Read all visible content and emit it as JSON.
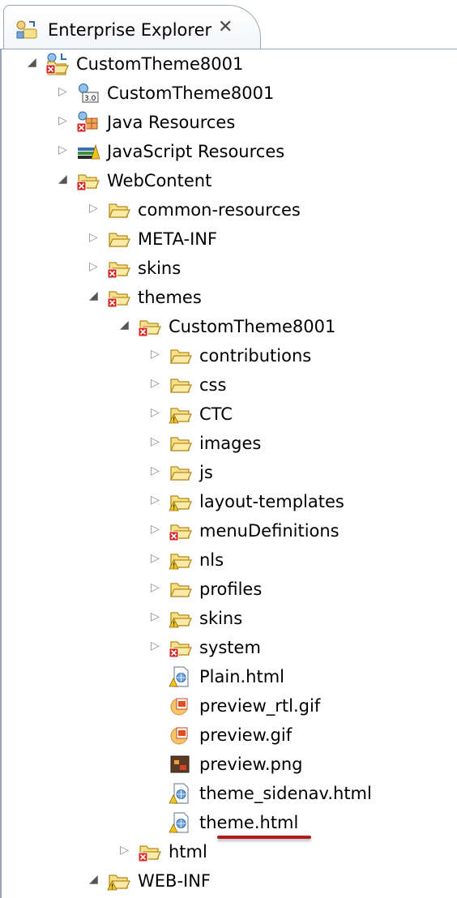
{
  "view": {
    "title": "Enterprise Explorer",
    "close_glyph": "✕"
  },
  "tree": [
    {
      "label": "CustomTheme8001",
      "depth": 0,
      "expanded": true,
      "icon": "project-icon"
    },
    {
      "label": "CustomTheme8001",
      "depth": 1,
      "expanded": false,
      "icon": "deployment-descriptor-icon"
    },
    {
      "label": "Java Resources",
      "depth": 1,
      "expanded": false,
      "icon": "java-resources-icon"
    },
    {
      "label": "JavaScript Resources",
      "depth": 1,
      "expanded": false,
      "icon": "javascript-resources-icon"
    },
    {
      "label": "WebContent",
      "depth": 1,
      "expanded": true,
      "icon": "folder-error-icon"
    },
    {
      "label": "common-resources",
      "depth": 2,
      "expanded": false,
      "icon": "folder-icon"
    },
    {
      "label": "META-INF",
      "depth": 2,
      "expanded": false,
      "icon": "folder-icon"
    },
    {
      "label": "skins",
      "depth": 2,
      "expanded": false,
      "icon": "folder-error-icon"
    },
    {
      "label": "themes",
      "depth": 2,
      "expanded": true,
      "icon": "folder-error-icon"
    },
    {
      "label": "CustomTheme8001",
      "depth": 3,
      "expanded": true,
      "icon": "folder-error-icon"
    },
    {
      "label": "contributions",
      "depth": 4,
      "expanded": false,
      "icon": "folder-icon"
    },
    {
      "label": "css",
      "depth": 4,
      "expanded": false,
      "icon": "folder-icon"
    },
    {
      "label": "CTC",
      "depth": 4,
      "expanded": false,
      "icon": "folder-warning-icon"
    },
    {
      "label": "images",
      "depth": 4,
      "expanded": false,
      "icon": "folder-icon"
    },
    {
      "label": "js",
      "depth": 4,
      "expanded": false,
      "icon": "folder-icon"
    },
    {
      "label": "layout-templates",
      "depth": 4,
      "expanded": false,
      "icon": "folder-warning-icon"
    },
    {
      "label": "menuDefinitions",
      "depth": 4,
      "expanded": false,
      "icon": "folder-error-icon"
    },
    {
      "label": "nls",
      "depth": 4,
      "expanded": false,
      "icon": "folder-warning-icon"
    },
    {
      "label": "profiles",
      "depth": 4,
      "expanded": false,
      "icon": "folder-icon"
    },
    {
      "label": "skins",
      "depth": 4,
      "expanded": false,
      "icon": "folder-warning-icon"
    },
    {
      "label": "system",
      "depth": 4,
      "expanded": false,
      "icon": "folder-error-icon"
    },
    {
      "label": "Plain.html",
      "depth": 4,
      "leaf": true,
      "icon": "html-file-warning-icon"
    },
    {
      "label": "preview_rtl.gif",
      "depth": 4,
      "leaf": true,
      "icon": "gif-file-icon"
    },
    {
      "label": "preview.gif",
      "depth": 4,
      "leaf": true,
      "icon": "gif-file-icon"
    },
    {
      "label": "preview.png",
      "depth": 4,
      "leaf": true,
      "icon": "png-file-icon"
    },
    {
      "label": "theme_sidenav.html",
      "depth": 4,
      "leaf": true,
      "icon": "html-file-warning-icon"
    },
    {
      "label": "theme.html",
      "depth": 4,
      "leaf": true,
      "icon": "html-file-warning-icon"
    },
    {
      "label": "html",
      "depth": 3,
      "expanded": false,
      "icon": "folder-error-icon"
    },
    {
      "label": "WEB-INF",
      "depth": 2,
      "expanded": true,
      "icon": "folder-warning-icon"
    }
  ],
  "colors": {
    "folder_fill": "#f7e08a",
    "folder_stroke": "#b58a1c",
    "error": "#d9231f",
    "warning": "#f3c11c",
    "accent_underline": "#b01c1c"
  }
}
